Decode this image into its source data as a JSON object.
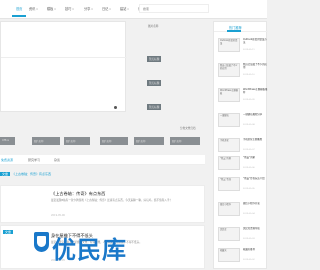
{
  "nav": {
    "items": [
      {
        "label": "首页",
        "active": true
      },
      {
        "label": "资讯",
        "caret": true
      },
      {
        "label": "模板",
        "caret": true
      },
      {
        "label": "技巧",
        "caret": true
      },
      {
        "label": "分享",
        "caret": true
      },
      {
        "label": "日记",
        "caret": true
      },
      {
        "label": "建站",
        "caret": true
      },
      {
        "label": "商城",
        "caret": false
      },
      {
        "label": "群聊",
        "caret": false
      }
    ],
    "search_placeholder": "搜索"
  },
  "slider": {
    "image_label": "图片名称",
    "captions": [
      "暂无标题",
      "暂无标题",
      "暂无标题"
    ]
  },
  "strip": [
    "Office",
    "图片名称",
    "图片名称",
    "图片名称",
    "图片名称",
    "图片名称"
  ],
  "section_title": "分类文章归档",
  "tabs": {
    "items": [
      "免费资源",
      "研究学习",
      "杂谈"
    ],
    "active_index": 0
  },
  "breadcrumb": {
    "chip": "文章",
    "text": "《上古卷轴：传奇》有点东西"
  },
  "articles": [
    {
      "title": "《上古卷轴：传奇》有点东西",
      "body": "最近发现B站有一款卡牌游戏《上古卷轴：传奇》还真有点东西，今天来聊一聊，好玩吗，值不值得入手？",
      "date": "2019-05-06"
    },
    {
      "chip": "文章",
      "title": "身在屋檐下不得不低头",
      "body": "最近在研究一篇关于屋檐的文章，有些感慨，人生就是身在屋檐下不得不低头。",
      "date": "2019-05-05"
    }
  ],
  "watermark": "优民库",
  "sidebar": {
    "heading": "热门推荐",
    "items": [
      {
        "img": "Outlook修复的错误",
        "title": "Outlook修复的错误方法",
        "date": "2019-05-11"
      },
      {
        "img": "我自己加载了不少的应用",
        "title": "我自己加载了不少的应用",
        "date": "2019-05-10"
      },
      {
        "img": "WordPress主题模板",
        "title": "WordPress主题模板推荐",
        "date": "2019-05-09"
      },
      {
        "img": "一键建站",
        "title": "一键建站教程分享",
        "date": "2019-05-08"
      },
      {
        "img": "手机美化",
        "title": "手机美化主题教程",
        "date": "2019-05-07"
      },
      {
        "img": "“我云”的家",
        "title": "“我云”的家",
        "date": "2019-05-06"
      },
      {
        "img": "“我云”传奇",
        "title": "“我云”传奇玩法介绍",
        "date": "2019-05-05"
      },
      {
        "img": "微信小程序",
        "title": "微信小程序开发",
        "date": "2019-05-04"
      },
      {
        "img": "优民库",
        "title": "优民库资源导航",
        "date": "2019-05-03"
      },
      {
        "img": "收藏夹",
        "title": "收藏夹推荐",
        "date": "2019-05-02"
      }
    ]
  },
  "colors": {
    "accent": "#1aa0d2",
    "watermark": "#1a78c9"
  }
}
